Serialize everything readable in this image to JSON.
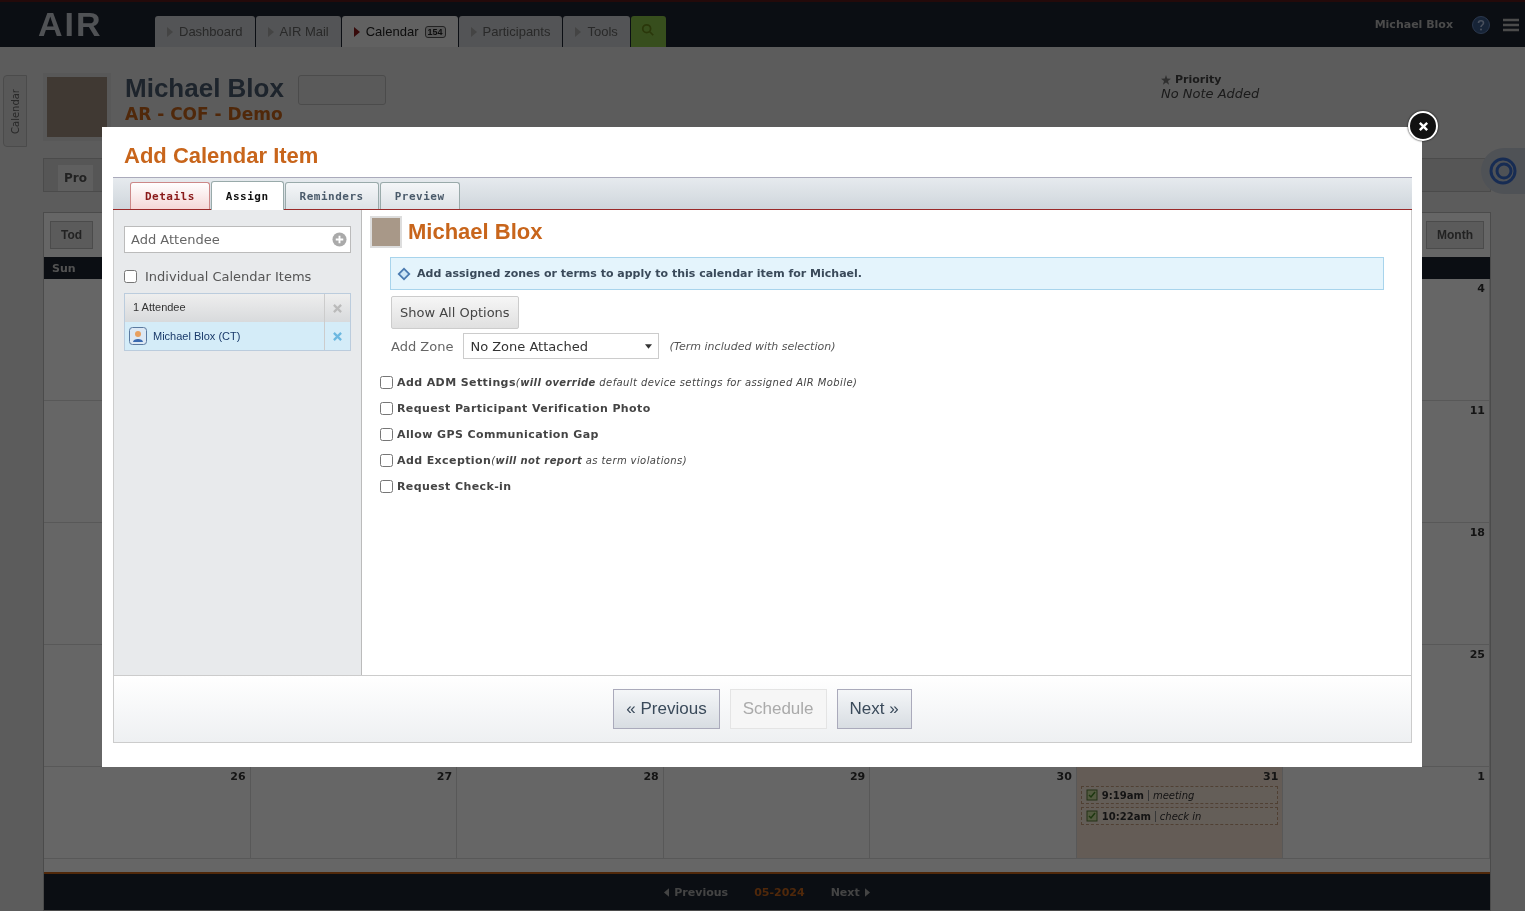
{
  "nav": {
    "logo": "AIR",
    "tabs": [
      {
        "label": "Dashboard",
        "selected": false
      },
      {
        "label": "AIR Mail",
        "selected": false
      },
      {
        "label": "Calendar",
        "selected": true,
        "badge": "154"
      },
      {
        "label": "Participants",
        "selected": false
      },
      {
        "label": "Tools",
        "selected": false
      }
    ],
    "user": "Michael Blox"
  },
  "side_tab": "Calendar",
  "profile": {
    "name": "Michael Blox",
    "subtitle": "AR - COF - Demo",
    "priority_label": "Priority",
    "note": "No Note Added"
  },
  "subnav": {
    "tab": "Pro"
  },
  "calendar": {
    "today_button": "Tod",
    "view_button": "Month",
    "weekday": "Sun",
    "weeks": [
      {
        "days": [
          {
            "number": "4",
            "today": false
          }
        ]
      },
      {
        "days": [
          {
            "number": "11",
            "today": false
          }
        ]
      },
      {
        "days": [
          {
            "number": "18",
            "today": false
          }
        ]
      },
      {
        "days": [
          {
            "number": "25",
            "today": false
          }
        ]
      },
      {
        "days": [
          {
            "number": "26",
            "today": false
          },
          {
            "number": "27",
            "today": false
          },
          {
            "number": "28",
            "today": false
          },
          {
            "number": "29",
            "today": false
          },
          {
            "number": "30",
            "today": false
          },
          {
            "number": "31",
            "today": true,
            "events": [
              {
                "time": "9:19am",
                "label": "meeting"
              },
              {
                "time": "10:22am",
                "label": "check in"
              }
            ]
          },
          {
            "number": "1",
            "today": false
          }
        ]
      }
    ],
    "footer": {
      "previous": "Previous",
      "month": "05-2024",
      "next": "Next"
    }
  },
  "modal": {
    "title": "Add Calendar Item",
    "tabs": [
      {
        "label": "Details",
        "selected": false
      },
      {
        "label": "Assign",
        "selected": true
      },
      {
        "label": "Reminders",
        "selected": false
      },
      {
        "label": "Preview",
        "selected": false
      }
    ],
    "attendee_field": {
      "placeholder": "Add Attendee"
    },
    "individual": {
      "label": "Individual Calendar Items",
      "checked": false
    },
    "attendee_header": "1 Attendee",
    "attendees": [
      {
        "name": "Michael Blox (CT)",
        "selected": true
      }
    ],
    "participant": "Michael Blox",
    "info": "Add assigned zones or terms to apply to this calendar item for Michael.",
    "show_all": "Show All Options",
    "zone": {
      "label": "Add Zone",
      "value": "No Zone Attached",
      "note": "(Term included with selection)"
    },
    "options": [
      {
        "label": "Add ADM Settings",
        "note": "(**will override** default device settings for assigned AIR Mobile)",
        "checked": false
      },
      {
        "label": "Request Participant Verification Photo",
        "checked": false
      },
      {
        "label": "Allow GPS Communication Gap",
        "checked": false
      },
      {
        "label": "Add Exception",
        "note": "(**will not report** as term violations)",
        "checked": false
      },
      {
        "label": "Request Check-in",
        "checked": false
      }
    ],
    "buttons": [
      {
        "label": "« Previous",
        "disabled": false
      },
      {
        "label": "Schedule",
        "disabled": true
      },
      {
        "label": "Next »",
        "disabled": false
      }
    ]
  }
}
